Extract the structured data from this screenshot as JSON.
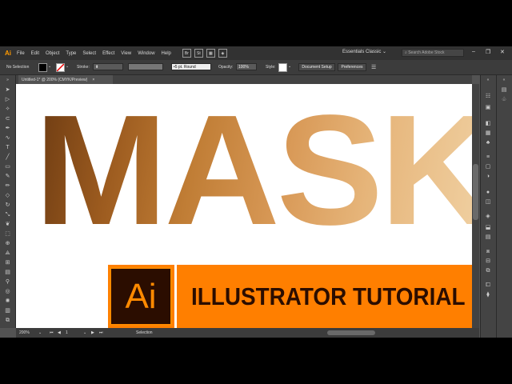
{
  "app": {
    "logo": "Ai",
    "menu": [
      "File",
      "Edit",
      "Object",
      "Type",
      "Select",
      "Effect",
      "View",
      "Window",
      "Help"
    ],
    "menubar_icons": [
      "Br",
      "St"
    ],
    "workspace": "Essentials Classic",
    "search_placeholder": "Search Adobe Stock",
    "window_controls": [
      "–",
      "❐",
      "✕"
    ]
  },
  "control_bar": {
    "selection": "No Selection",
    "stroke_label": "Stroke:",
    "brush": "5 pt. Round",
    "opacity_label": "Opacity:",
    "opacity_value": "100%",
    "style_label": "Style:",
    "document_setup": "Document Setup",
    "preferences": "Preferences"
  },
  "document": {
    "tab_title": "Untitled-1* @ 200% (CMYK/Preview)",
    "close": "×"
  },
  "artwork": {
    "mask_word": "MASK",
    "ai_logo": "Ai",
    "banner_text": "ILLUSTRATOR TUTORIAL",
    "colors": {
      "banner": "#ff7f00",
      "logo_bg": "#2b0d00",
      "logo_fg": "#ff8a00"
    }
  },
  "status": {
    "zoom": "200%",
    "page": "1",
    "tool": "Selection"
  },
  "icons": {
    "tools": [
      "selection-icon",
      "direct-selection-icon",
      "magic-wand-icon",
      "lasso-icon",
      "pen-icon",
      "curvature-icon",
      "type-icon",
      "line-icon",
      "rectangle-icon",
      "paintbrush-icon",
      "pencil-icon",
      "eraser-icon",
      "rotate-icon",
      "scale-icon",
      "warp-icon",
      "free-transform-icon",
      "shape-builder-icon",
      "perspective-icon",
      "mesh-icon",
      "gradient-icon",
      "eyedropper-icon",
      "blend-icon",
      "symbol-sprayer-icon",
      "graph-icon",
      "artboard-icon",
      "slice-icon",
      "hand-icon",
      "zoom-icon"
    ],
    "panels": [
      "color-icon",
      "color-guide-icon",
      "swatches-icon",
      "brushes-icon",
      "symbols-icon",
      "stroke-icon",
      "gradient-panel-icon",
      "transparency-icon",
      "appearance-icon",
      "graphic-styles-icon",
      "layers-icon",
      "asset-export-icon",
      "artboards-icon",
      "transform-icon",
      "align-icon",
      "pathfinder-icon"
    ]
  }
}
